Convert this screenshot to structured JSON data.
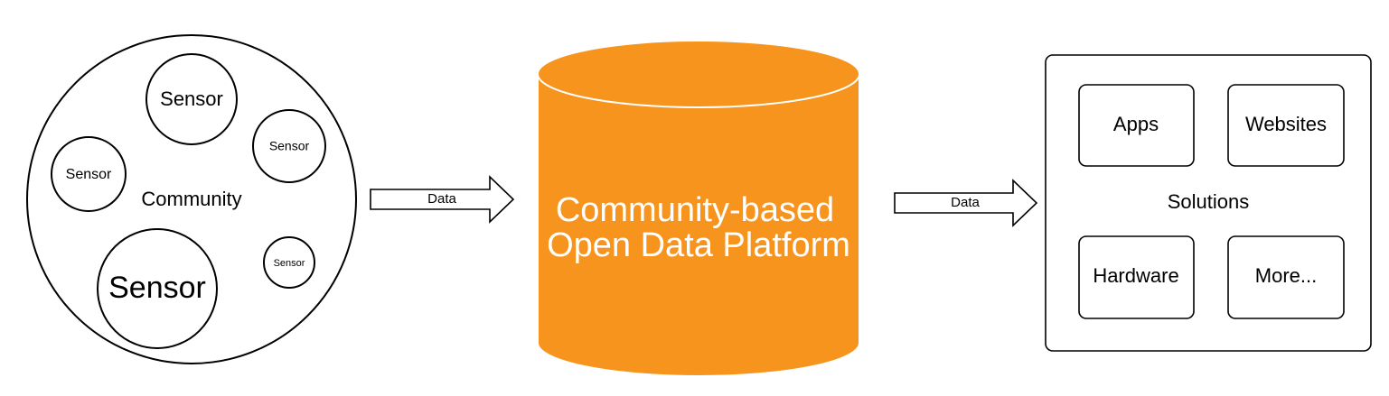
{
  "community": {
    "label": "Community",
    "sensors": [
      {
        "label": "Sensor"
      },
      {
        "label": "Sensor"
      },
      {
        "label": "Sensor"
      },
      {
        "label": "Sensor"
      },
      {
        "label": "Sensor"
      }
    ]
  },
  "arrows": {
    "left_label": "Data",
    "right_label": "Data"
  },
  "platform": {
    "line1": "Community-based",
    "line2": "Open Data Platform",
    "color": "#F7941D"
  },
  "solutions": {
    "label": "Solutions",
    "items": [
      {
        "label": "Apps"
      },
      {
        "label": "Websites"
      },
      {
        "label": "Hardware"
      },
      {
        "label": "More..."
      }
    ]
  }
}
